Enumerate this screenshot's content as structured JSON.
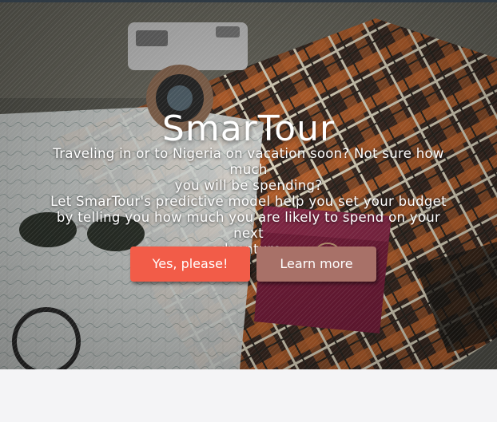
{
  "hero": {
    "title": "SmarTour",
    "tagline_lines": [
      "Traveling in or to Nigeria on vacation soon? Not sure how much",
      "you will be spending?",
      "Let SmarTour's predictive model help you set your budget",
      "by telling you how much you are likely to spend on your next",
      "adventure."
    ],
    "primary_button_label": "Yes, please!",
    "secondary_button_label": "Learn more"
  },
  "colors": {
    "primary_button": "#f25c48",
    "secondary_button": "#a87168",
    "page_background": "#f4f4f6",
    "top_bar": "#2f3a44"
  }
}
